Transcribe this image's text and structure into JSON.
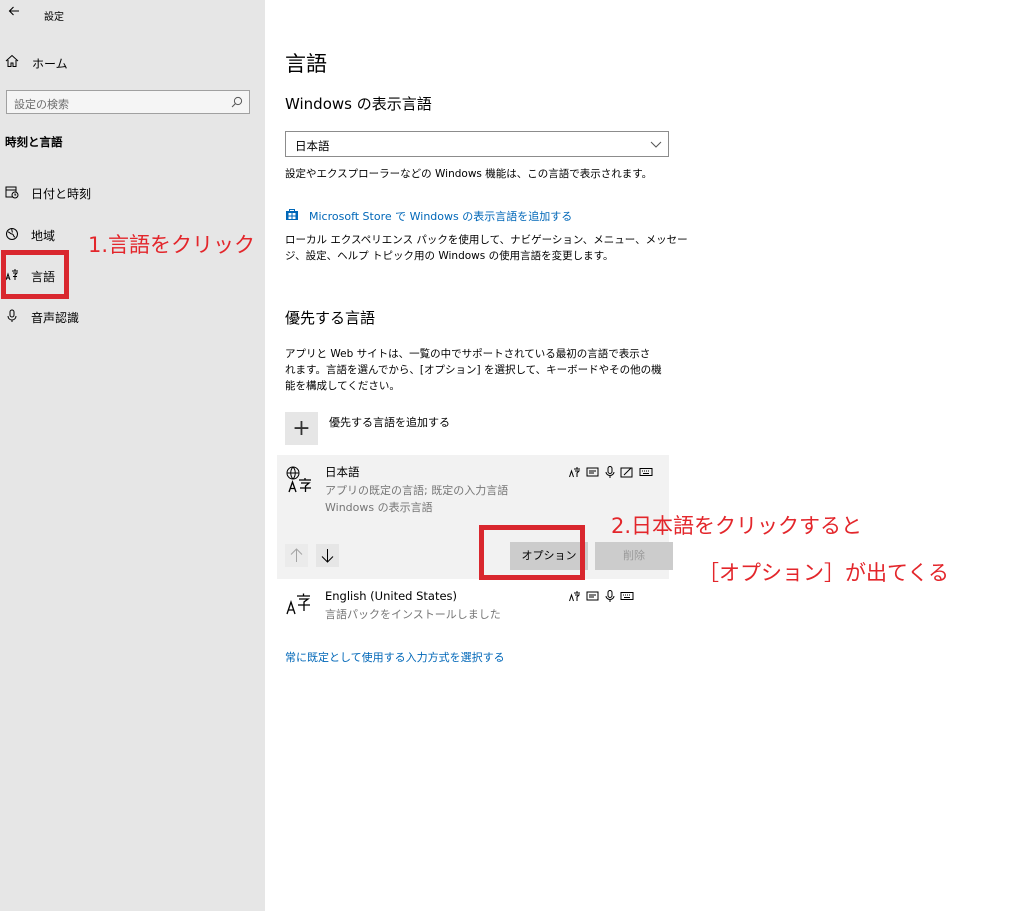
{
  "window": {
    "back_icon": "back-arrow-icon",
    "title": "設定"
  },
  "sidebar": {
    "home_label": "ホーム",
    "search_placeholder": "設定の検索",
    "section_heading": "時刻と言語",
    "items": [
      {
        "label": "日付と時刻",
        "icon": "calendar-clock-icon"
      },
      {
        "label": "地域",
        "icon": "globe-region-icon"
      },
      {
        "label": "言語",
        "icon": "language-icon"
      },
      {
        "label": "音声認識",
        "icon": "microphone-icon"
      }
    ]
  },
  "main": {
    "title": "言語",
    "display_language_heading": "Windows の表示言語",
    "display_language_value": "日本語",
    "display_language_desc": "設定やエクスプローラーなどの Windows 機能は、この言語で表示されます。",
    "store_link": "Microsoft Store で Windows の表示言語を追加する",
    "store_desc_1": "ローカル エクスペリエンス パックを使用して、ナビゲーション、メニュー、メッセー",
    "store_desc_2": "ジ、設定、ヘルプ トピック用の Windows の使用言語を変更します。",
    "preferred_heading": "優先する言語",
    "preferred_desc_1": "アプリと Web サイトは、一覧の中でサポートされている最初の言語で表示さ",
    "preferred_desc_2": "れます。言語を選んでから、[オプション] を選択して、キーボードやその他の機",
    "preferred_desc_3": "能を構成してください。",
    "add_language_label": "優先する言語を追加する",
    "languages": [
      {
        "name": "日本語",
        "sub1": "アプリの既定の言語; 既定の入力言語",
        "sub2": "Windows の表示言語",
        "features": [
          "display-language-icon",
          "text-to-speech-icon",
          "speech-recognition-icon",
          "handwriting-icon",
          "keyboard-icon"
        ]
      },
      {
        "name": "English (United States)",
        "sub1": "言語パックをインストールしました",
        "features": [
          "display-language-icon",
          "text-to-speech-icon",
          "speech-recognition-icon",
          "keyboard-icon"
        ]
      }
    ],
    "options_button": "オプション",
    "remove_button": "削除",
    "default_input_link": "常に既定として使用する入力方式を選択する"
  },
  "annotations": {
    "step1": "1.言語をクリック",
    "step2": "2.日本語をクリックすると",
    "step3": "［オプション］が出てくる",
    "highlight_color": "#d9272e"
  }
}
